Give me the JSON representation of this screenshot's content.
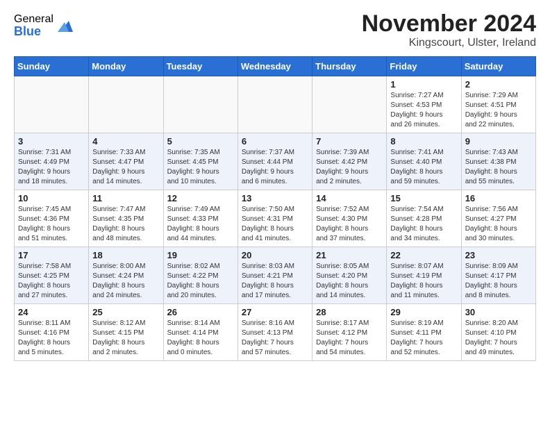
{
  "logo": {
    "general": "General",
    "blue": "Blue"
  },
  "title": "November 2024",
  "location": "Kingscourt, Ulster, Ireland",
  "days_of_week": [
    "Sunday",
    "Monday",
    "Tuesday",
    "Wednesday",
    "Thursday",
    "Friday",
    "Saturday"
  ],
  "weeks": [
    [
      {
        "day": "",
        "info": ""
      },
      {
        "day": "",
        "info": ""
      },
      {
        "day": "",
        "info": ""
      },
      {
        "day": "",
        "info": ""
      },
      {
        "day": "",
        "info": ""
      },
      {
        "day": "1",
        "info": "Sunrise: 7:27 AM\nSunset: 4:53 PM\nDaylight: 9 hours\nand 26 minutes."
      },
      {
        "day": "2",
        "info": "Sunrise: 7:29 AM\nSunset: 4:51 PM\nDaylight: 9 hours\nand 22 minutes."
      }
    ],
    [
      {
        "day": "3",
        "info": "Sunrise: 7:31 AM\nSunset: 4:49 PM\nDaylight: 9 hours\nand 18 minutes."
      },
      {
        "day": "4",
        "info": "Sunrise: 7:33 AM\nSunset: 4:47 PM\nDaylight: 9 hours\nand 14 minutes."
      },
      {
        "day": "5",
        "info": "Sunrise: 7:35 AM\nSunset: 4:45 PM\nDaylight: 9 hours\nand 10 minutes."
      },
      {
        "day": "6",
        "info": "Sunrise: 7:37 AM\nSunset: 4:44 PM\nDaylight: 9 hours\nand 6 minutes."
      },
      {
        "day": "7",
        "info": "Sunrise: 7:39 AM\nSunset: 4:42 PM\nDaylight: 9 hours\nand 2 minutes."
      },
      {
        "day": "8",
        "info": "Sunrise: 7:41 AM\nSunset: 4:40 PM\nDaylight: 8 hours\nand 59 minutes."
      },
      {
        "day": "9",
        "info": "Sunrise: 7:43 AM\nSunset: 4:38 PM\nDaylight: 8 hours\nand 55 minutes."
      }
    ],
    [
      {
        "day": "10",
        "info": "Sunrise: 7:45 AM\nSunset: 4:36 PM\nDaylight: 8 hours\nand 51 minutes."
      },
      {
        "day": "11",
        "info": "Sunrise: 7:47 AM\nSunset: 4:35 PM\nDaylight: 8 hours\nand 48 minutes."
      },
      {
        "day": "12",
        "info": "Sunrise: 7:49 AM\nSunset: 4:33 PM\nDaylight: 8 hours\nand 44 minutes."
      },
      {
        "day": "13",
        "info": "Sunrise: 7:50 AM\nSunset: 4:31 PM\nDaylight: 8 hours\nand 41 minutes."
      },
      {
        "day": "14",
        "info": "Sunrise: 7:52 AM\nSunset: 4:30 PM\nDaylight: 8 hours\nand 37 minutes."
      },
      {
        "day": "15",
        "info": "Sunrise: 7:54 AM\nSunset: 4:28 PM\nDaylight: 8 hours\nand 34 minutes."
      },
      {
        "day": "16",
        "info": "Sunrise: 7:56 AM\nSunset: 4:27 PM\nDaylight: 8 hours\nand 30 minutes."
      }
    ],
    [
      {
        "day": "17",
        "info": "Sunrise: 7:58 AM\nSunset: 4:25 PM\nDaylight: 8 hours\nand 27 minutes."
      },
      {
        "day": "18",
        "info": "Sunrise: 8:00 AM\nSunset: 4:24 PM\nDaylight: 8 hours\nand 24 minutes."
      },
      {
        "day": "19",
        "info": "Sunrise: 8:02 AM\nSunset: 4:22 PM\nDaylight: 8 hours\nand 20 minutes."
      },
      {
        "day": "20",
        "info": "Sunrise: 8:03 AM\nSunset: 4:21 PM\nDaylight: 8 hours\nand 17 minutes."
      },
      {
        "day": "21",
        "info": "Sunrise: 8:05 AM\nSunset: 4:20 PM\nDaylight: 8 hours\nand 14 minutes."
      },
      {
        "day": "22",
        "info": "Sunrise: 8:07 AM\nSunset: 4:19 PM\nDaylight: 8 hours\nand 11 minutes."
      },
      {
        "day": "23",
        "info": "Sunrise: 8:09 AM\nSunset: 4:17 PM\nDaylight: 8 hours\nand 8 minutes."
      }
    ],
    [
      {
        "day": "24",
        "info": "Sunrise: 8:11 AM\nSunset: 4:16 PM\nDaylight: 8 hours\nand 5 minutes."
      },
      {
        "day": "25",
        "info": "Sunrise: 8:12 AM\nSunset: 4:15 PM\nDaylight: 8 hours\nand 2 minutes."
      },
      {
        "day": "26",
        "info": "Sunrise: 8:14 AM\nSunset: 4:14 PM\nDaylight: 8 hours\nand 0 minutes."
      },
      {
        "day": "27",
        "info": "Sunrise: 8:16 AM\nSunset: 4:13 PM\nDaylight: 7 hours\nand 57 minutes."
      },
      {
        "day": "28",
        "info": "Sunrise: 8:17 AM\nSunset: 4:12 PM\nDaylight: 7 hours\nand 54 minutes."
      },
      {
        "day": "29",
        "info": "Sunrise: 8:19 AM\nSunset: 4:11 PM\nDaylight: 7 hours\nand 52 minutes."
      },
      {
        "day": "30",
        "info": "Sunrise: 8:20 AM\nSunset: 4:10 PM\nDaylight: 7 hours\nand 49 minutes."
      }
    ]
  ]
}
